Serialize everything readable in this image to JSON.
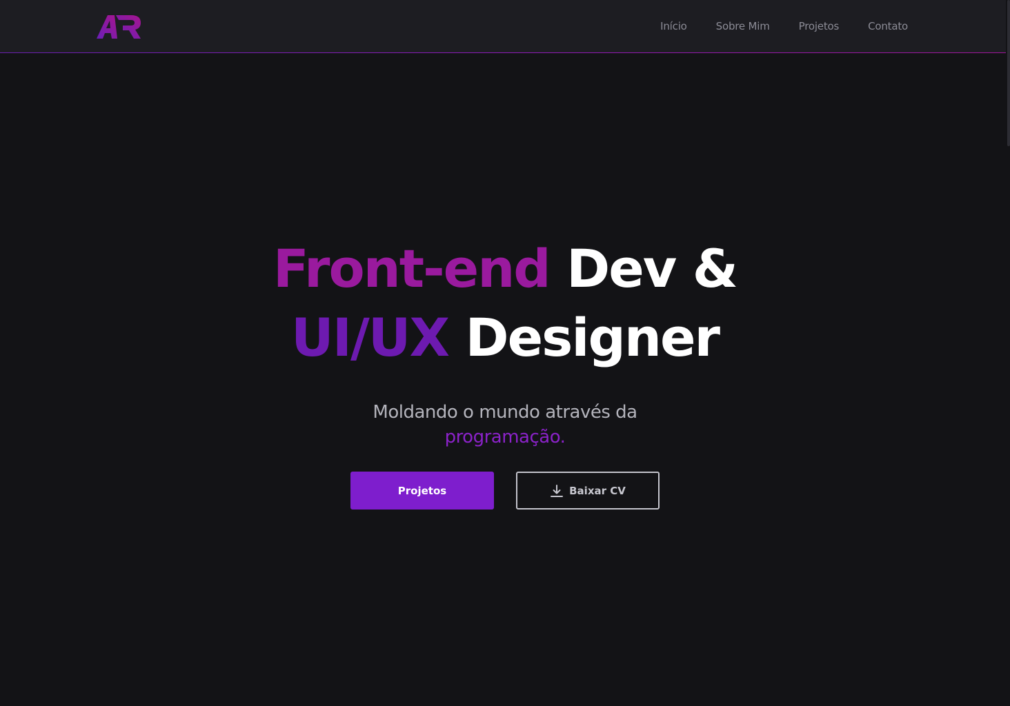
{
  "header": {
    "logo_text": "AR",
    "nav": [
      {
        "label": "Início"
      },
      {
        "label": "Sobre Mim"
      },
      {
        "label": "Projetos"
      },
      {
        "label": "Contato"
      }
    ]
  },
  "hero": {
    "title_line1_accent": "Front-end",
    "title_line1_rest": " Dev &",
    "title_line2_accent": "UI/UX",
    "title_line2_rest": " Designer",
    "subtitle_text": "Moldando o mundo através da",
    "subtitle_highlight": "programação.",
    "primary_button": "Projetos",
    "secondary_button": "Baixar CV",
    "secondary_button_icon": "download-icon"
  },
  "colors": {
    "background": "#131316",
    "header_bg": "#1d1d22",
    "accent_magenta": "#9a1a9e",
    "accent_purple": "#6d1ab0",
    "button_purple": "#7e1ecd",
    "highlight": "#8b22c9"
  }
}
